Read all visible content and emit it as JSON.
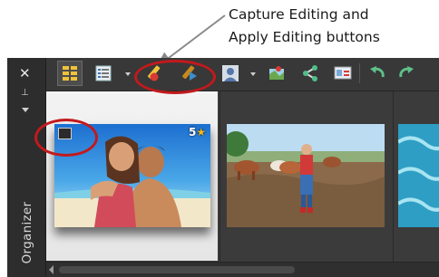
{
  "callout": {
    "line1": "Capture Editing and",
    "line2": "Apply Editing buttons"
  },
  "panel": {
    "side_label": "Organizer",
    "close_glyph": "✕",
    "pin_glyph": "⊥"
  },
  "toolbar": {
    "icons": [
      "thumbnail-view-icon",
      "details-view-icon",
      "capture-editing-icon",
      "apply-editing-icon",
      "people-icon",
      "map-icon",
      "share-icon",
      "filmstrip-edit-icon",
      "rotate-left-icon",
      "rotate-right-icon"
    ]
  },
  "thumbnails": [
    {
      "subject": "couple at beach",
      "rating": "5",
      "rating_glyph": "★",
      "selected": true
    },
    {
      "subject": "child with cows",
      "selected": false
    },
    {
      "subject": "water",
      "selected": false
    }
  ],
  "colors": {
    "highlight_ring": "#c3191c",
    "star": "#f3b81c",
    "panel_bg": "#3a3a3a"
  }
}
